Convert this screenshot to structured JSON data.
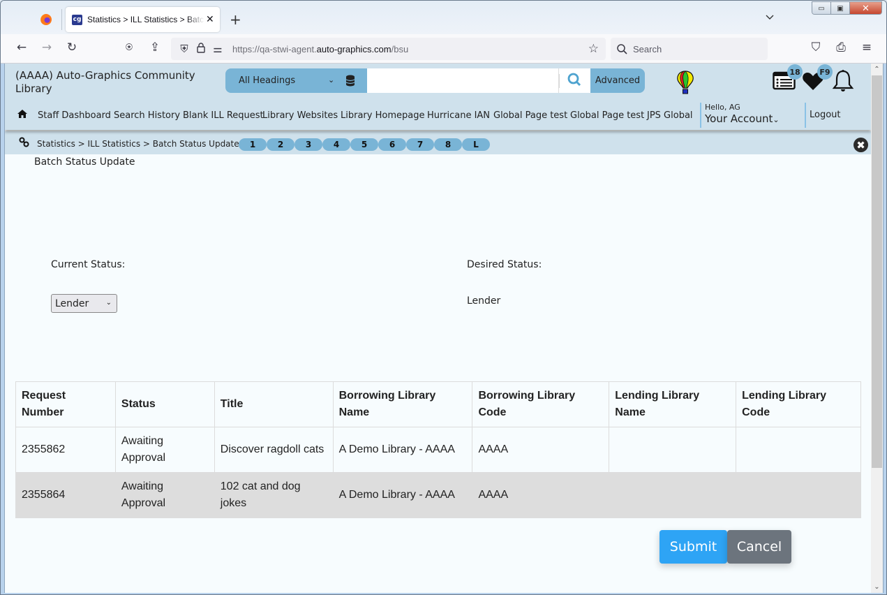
{
  "browser": {
    "tab_title": "Statistics > ILL Statistics > Batch Status Update",
    "tab_favicon": "cg",
    "url_prefix": "https://qa-stwi-agent.",
    "url_domain": "auto-graphics.com",
    "url_path": "/bsu",
    "search_placeholder": "Search",
    "icons": {
      "back": "←",
      "forward": "→",
      "reload": "↻",
      "new_tab": "+",
      "tab_list": "⌄",
      "minimize": "▭",
      "maximize": "▣",
      "close": "✕",
      "tab_close": "✕",
      "star": "☆",
      "search": "⌕",
      "pocket": "⛉",
      "print": "⎙",
      "menu": "≡",
      "shield": "⛨",
      "lock": "🔒",
      "permissions": "⚌",
      "save_page": "⍟",
      "share": "⇪"
    }
  },
  "header": {
    "library_name": "(AAAA) Auto-Graphics Community Library",
    "search": {
      "heading_select": "All Headings",
      "query": "",
      "advanced_label": "Advanced"
    },
    "badges": {
      "list_count": "18",
      "favorites": "F9"
    },
    "nav": [
      "Staff Dashboard",
      "Search History",
      "Blank ILL Request",
      "Library Websites",
      "Library Homepage",
      "Hurricane IAN",
      "Global Page test",
      "Global Page test",
      "JPS Global"
    ],
    "greeting": "Hello, AG",
    "account_label": "Your Account",
    "logout_label": "Logout"
  },
  "breadcrumb": {
    "text": "Statistics > ILL Statistics > Batch Status Update",
    "pages": [
      "1",
      "2",
      "3",
      "4",
      "5",
      "6",
      "7",
      "8",
      "L"
    ]
  },
  "page": {
    "title": "Batch Status Update",
    "current_status_label": "Current Status:",
    "current_status_value": "Lender",
    "desired_status_label": "Desired Status:",
    "desired_status_value": "Lender"
  },
  "table": {
    "headers": [
      "Request Number",
      "Status",
      "Title",
      "Borrowing Library Name",
      "Borrowing Library Code",
      "Lending Library Name",
      "Lending Library Code"
    ],
    "rows": [
      [
        "2355862",
        "Awaiting Approval",
        "Discover ragdoll cats",
        "A Demo Library - AAAA",
        "AAAA",
        "",
        ""
      ],
      [
        "2355864",
        "Awaiting Approval",
        "102 cat and dog jokes",
        "A Demo Library - AAAA",
        "AAAA",
        "",
        ""
      ]
    ]
  },
  "actions": {
    "submit": "Submit",
    "cancel": "Cancel"
  },
  "colors": {
    "header_bg": "#cfe1ec",
    "accent": "#79b4d6",
    "submit": "#2ea4f5",
    "cancel": "#6c747d",
    "alt_row": "#dddddd"
  }
}
